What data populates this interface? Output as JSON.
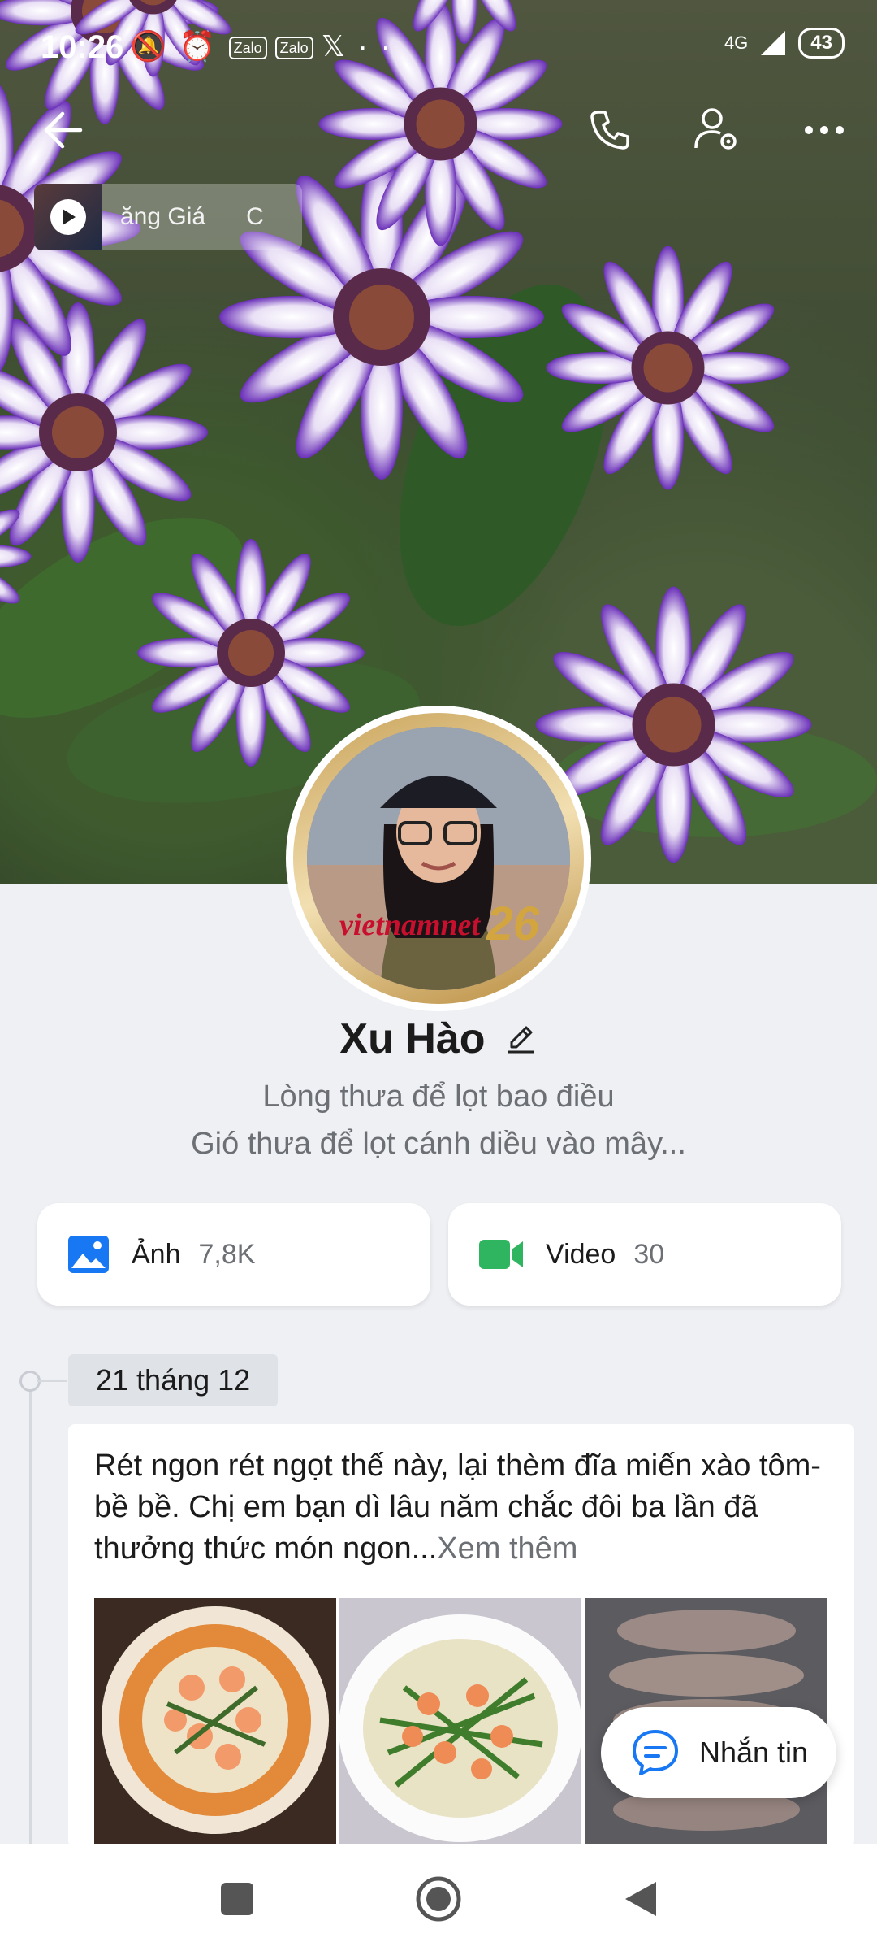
{
  "status_bar": {
    "time": "10:26",
    "notification_icons": [
      "bell-off-icon",
      "alarm-icon",
      "zalo-icon",
      "zalo-icon",
      "x-icon",
      "more-dots-icon"
    ],
    "zalo_label": "Zalo",
    "network": "4G",
    "battery": "43"
  },
  "header": {
    "back_icon": "back-arrow-icon",
    "call_icon": "phone-icon",
    "settings_icon": "user-settings-icon",
    "more_icon": "more-icon"
  },
  "music": {
    "text": "ăng Giá      C"
  },
  "profile": {
    "name": "Xu Hào",
    "bio_line1": "Lòng thưa để lọt bao điều",
    "bio_line2": "Gió thưa để lọt cánh diều vào mây...",
    "avatar_badge": "vietnamnet",
    "avatar_badge_number": "26"
  },
  "media": {
    "photos_label": "Ảnh",
    "photos_count": "7,8K",
    "videos_label": "Video",
    "videos_count": "30"
  },
  "timeline": {
    "date": "21 tháng 12",
    "post_text": "Rét ngon rét ngọt thế này, lại thèm đĩa miến xào tôm-bề bề. Chị em bạn dì lâu năm chắc đôi ba lần đã thưởng thức món ngon...",
    "see_more": "Xem thêm"
  },
  "message_button": {
    "label": "Nhắn tin"
  },
  "colors": {
    "accent_blue": "#1877f2",
    "video_green": "#2fb45f",
    "background": "#eef0f4"
  }
}
